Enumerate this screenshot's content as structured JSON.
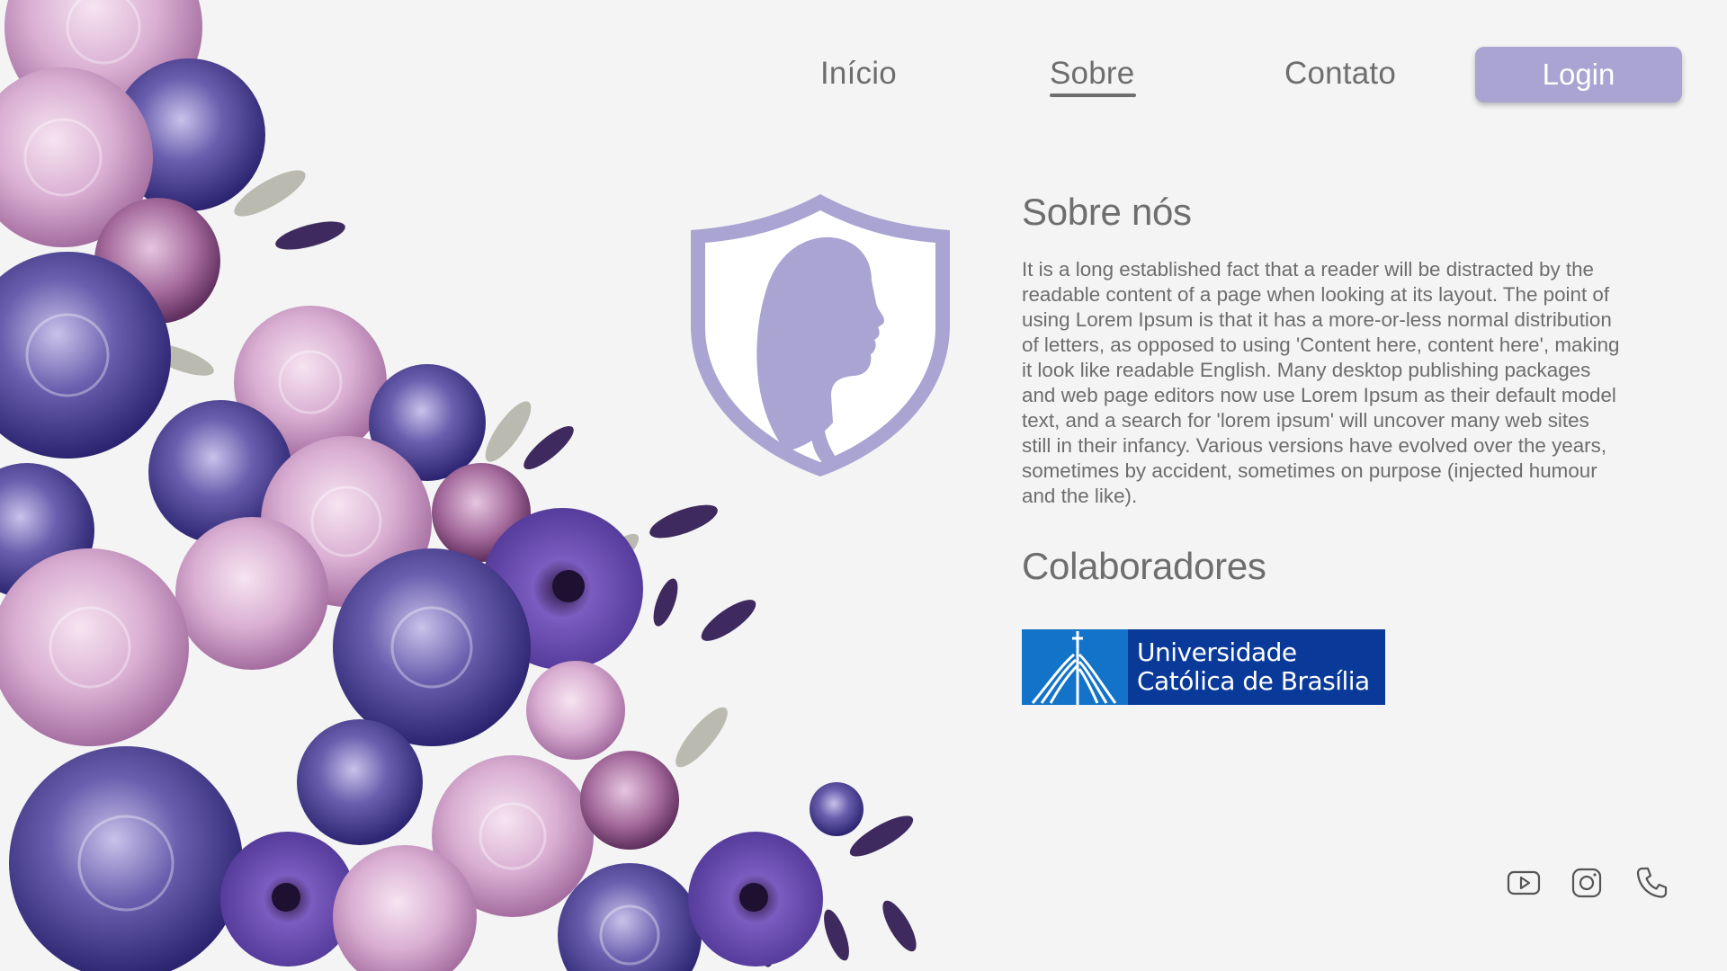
{
  "nav": {
    "items": [
      {
        "label": "Início"
      },
      {
        "label": "Sobre"
      },
      {
        "label": "Contato"
      }
    ],
    "login_label": "Login"
  },
  "about": {
    "title": "Sobre nós",
    "body": "It is a long established fact that a reader will be distracted by the\nreadable content of a page when looking at its layout. The point of\nusing Lorem Ipsum is that it has a more-or-less normal distribution\nof  letters, as opposed to using 'Content here, content here', making\nit  look like readable English. Many desktop publishing packages\nand web  page editors now use Lorem Ipsum as their default model\ntext, and a  search for 'lorem ipsum' will uncover many web sites\nstill in their  infancy. Various versions have evolved over the years,\nsometimes by  accident, sometimes on purpose (injected humour\nand the like)."
  },
  "collaborators": {
    "title": "Colaboradores",
    "logo_line1": "Universidade",
    "logo_line2": "Católica de Brasília"
  },
  "social": [
    "youtube-icon",
    "instagram-icon",
    "phone-icon"
  ],
  "colors": {
    "accent": "#a9a4d2",
    "background": "#f4f4f4",
    "text": "#6e6e6e",
    "ucb_blue": "#0a3a99"
  }
}
